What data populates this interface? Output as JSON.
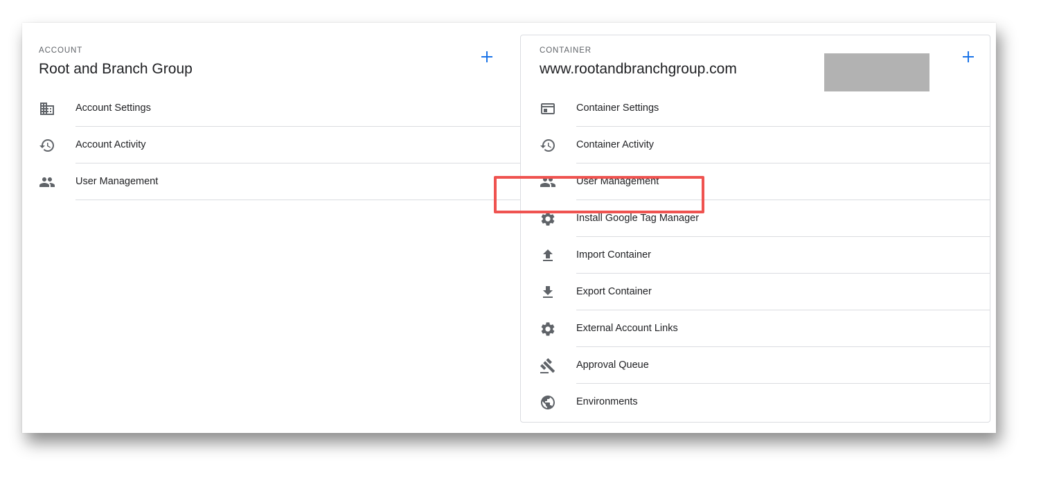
{
  "account": {
    "section_label": "ACCOUNT",
    "name": "Root and Branch Group",
    "add_icon": "plus-icon",
    "items": [
      {
        "label": "Account Settings",
        "icon": "building-icon"
      },
      {
        "label": "Account Activity",
        "icon": "history-icon"
      },
      {
        "label": "User Management",
        "icon": "people-icon"
      }
    ]
  },
  "container": {
    "section_label": "CONTAINER",
    "name": "www.rootandbranchgroup.com",
    "add_icon": "plus-icon",
    "items": [
      {
        "label": "Container Settings",
        "icon": "window-icon"
      },
      {
        "label": "Container Activity",
        "icon": "history-icon"
      },
      {
        "label": "User Management",
        "icon": "people-icon"
      },
      {
        "label": "Install Google Tag Manager",
        "icon": "gear-icon",
        "highlighted": true
      },
      {
        "label": "Import Container",
        "icon": "upload-icon"
      },
      {
        "label": "Export Container",
        "icon": "download-icon"
      },
      {
        "label": "External Account Links",
        "icon": "gear-icon"
      },
      {
        "label": "Approval Queue",
        "icon": "gavel-icon"
      },
      {
        "label": "Environments",
        "icon": "globe-icon"
      }
    ]
  },
  "colors": {
    "accent": "#1a73e8",
    "highlight": "#ef5350",
    "icon": "#5f6368",
    "divider": "#dadce0",
    "redaction": "#b2b2b2"
  }
}
